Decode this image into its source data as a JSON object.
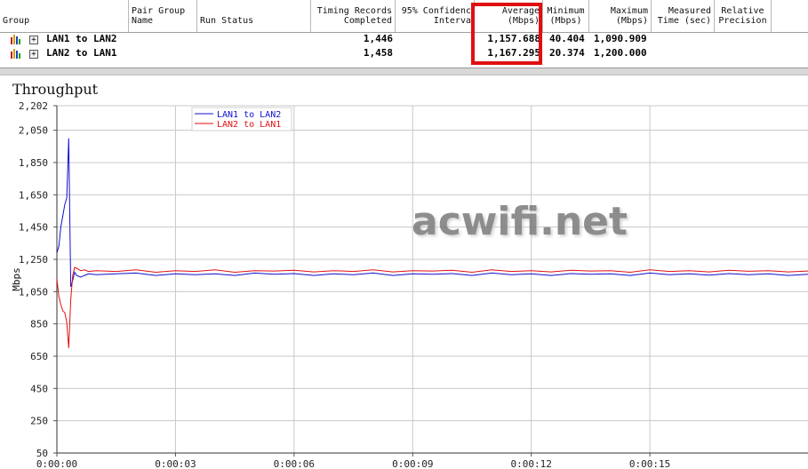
{
  "table": {
    "headers": {
      "group": "Group",
      "pair_group_name": "Pair Group\nName",
      "run_status": "Run Status",
      "timing_records": "Timing Records\nCompleted",
      "confidence": "95% Confidenc\nInterva",
      "average": "Average\n(Mbps)",
      "minimum": "Minimum\n(Mbps)",
      "maximum": "Maximum\n(Mbps)",
      "measured_time": "Measured\nTime (sec)",
      "relative_precision": "Relative\nPrecision"
    },
    "rows": [
      {
        "name": "LAN1 to LAN2",
        "expand": "+",
        "records": "1,446",
        "average": "1,157.688",
        "minimum": "40.404",
        "maximum": "1,090.909"
      },
      {
        "name": "LAN2 to LAN1",
        "expand": "+",
        "records": "1,458",
        "average": "1,167.295",
        "minimum": "20.374",
        "maximum": "1,200.000"
      }
    ]
  },
  "chart_title": "Throughput",
  "watermark": "acwifi.net",
  "colors": {
    "series1": "#1010d0",
    "series2": "#e01010",
    "highlight": "#e01010",
    "grid": "#c8c8c8"
  },
  "chart_data": {
    "type": "line",
    "title": "Throughput",
    "xlabel": "",
    "ylabel": "Mbps",
    "ylim": [
      50,
      2202
    ],
    "xlim": [
      0,
      19
    ],
    "yticks": [
      "2,202",
      "2,050",
      "1,850",
      "1,650",
      "1,450",
      "1,250",
      "1,050",
      "850",
      "650",
      "450",
      "250",
      "50"
    ],
    "ytick_values": [
      2202,
      2050,
      1850,
      1650,
      1450,
      1250,
      1050,
      850,
      650,
      450,
      250,
      50
    ],
    "xticks": [
      "0:00:00",
      "0:00:03",
      "0:00:06",
      "0:00:09",
      "0:00:12",
      "0:00:15"
    ],
    "xtick_values": [
      0,
      3,
      6,
      9,
      12,
      15
    ],
    "legend_position": "top-left",
    "grid": true,
    "series": [
      {
        "name": "LAN1 to LAN2",
        "color": "#1010d0",
        "x": [
          0.0,
          0.05,
          0.1,
          0.15,
          0.2,
          0.25,
          0.3,
          0.35,
          0.4,
          0.45,
          0.5,
          0.6,
          0.7,
          0.8,
          1.0,
          1.5,
          2.0,
          2.5,
          3.0,
          3.5,
          4.0,
          4.5,
          5.0,
          5.5,
          6.0,
          6.5,
          7.0,
          7.5,
          8.0,
          8.5,
          9.0,
          9.5,
          10.0,
          10.5,
          11.0,
          11.5,
          12.0,
          12.5,
          13.0,
          13.5,
          14.0,
          14.5,
          15.0,
          15.5,
          16.0,
          16.5,
          17.0,
          17.5,
          18.0,
          18.5,
          19.0
        ],
        "y": [
          1290,
          1330,
          1450,
          1520,
          1590,
          1630,
          2000,
          1080,
          1120,
          1170,
          1150,
          1140,
          1150,
          1160,
          1155,
          1160,
          1165,
          1150,
          1160,
          1155,
          1160,
          1150,
          1165,
          1158,
          1162,
          1150,
          1160,
          1155,
          1165,
          1150,
          1160,
          1158,
          1162,
          1150,
          1165,
          1155,
          1160,
          1150,
          1162,
          1158,
          1160,
          1150,
          1165,
          1155,
          1160,
          1152,
          1162,
          1155,
          1160,
          1150,
          1158
        ]
      },
      {
        "name": "LAN2 to LAN1",
        "color": "#e01010",
        "x": [
          0.0,
          0.05,
          0.1,
          0.15,
          0.2,
          0.25,
          0.3,
          0.35,
          0.4,
          0.45,
          0.5,
          0.6,
          0.7,
          0.8,
          1.0,
          1.5,
          2.0,
          2.5,
          3.0,
          3.5,
          4.0,
          4.5,
          5.0,
          5.5,
          6.0,
          6.5,
          7.0,
          7.5,
          8.0,
          8.5,
          9.0,
          9.5,
          10.0,
          10.5,
          11.0,
          11.5,
          12.0,
          12.5,
          13.0,
          13.5,
          14.0,
          14.5,
          15.0,
          15.5,
          16.0,
          16.5,
          17.0,
          17.5,
          18.0,
          18.5,
          19.0
        ],
        "y": [
          1130,
          1020,
          970,
          930,
          920,
          860,
          700,
          1000,
          1150,
          1200,
          1195,
          1180,
          1185,
          1175,
          1180,
          1175,
          1185,
          1170,
          1180,
          1175,
          1185,
          1170,
          1180,
          1178,
          1182,
          1172,
          1180,
          1175,
          1185,
          1172,
          1180,
          1178,
          1182,
          1170,
          1185,
          1175,
          1180,
          1172,
          1182,
          1178,
          1180,
          1170,
          1185,
          1175,
          1180,
          1172,
          1182,
          1176,
          1180,
          1172,
          1178
        ]
      }
    ]
  }
}
